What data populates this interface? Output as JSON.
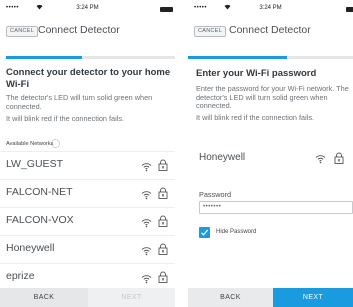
{
  "left_screen": {
    "status": {
      "signal": "•••••",
      "time": "3:24 PM"
    },
    "header": {
      "cancel": "CANCEL",
      "title": "Connect Detector"
    },
    "progress": 0.45,
    "title": "Connect your detector to your home Wi-Fi",
    "desc1": "The detector's LED will turn solid green when connected.",
    "desc2": "It will blink red if the connection fails.",
    "available_label": "Available Networks",
    "networks": [
      "LW_GUEST",
      "FALCON-NET",
      "FALCON-VOX",
      "Honeywell",
      "eprize"
    ],
    "footer": {
      "back": "BACK",
      "next": "NEXT"
    }
  },
  "right_screen": {
    "status": {
      "signal": "•••••",
      "time": "3:24 PM"
    },
    "header": {
      "cancel": "CANCEL",
      "title": "Connect Detector"
    },
    "progress": 0.6,
    "title": "Enter your Wi-Fi password",
    "desc1": "Enter the password for your Wi-Fi network. The detector's LED will turn solid green when connected.",
    "desc2": "It will blink red if the connection fails.",
    "selected_network": "Honeywell",
    "password_label": "Password",
    "password_value": "•••••••",
    "hide_password_label": "Hide Password",
    "hide_password_checked": true,
    "footer": {
      "back": "BACK",
      "next": "NEXT"
    }
  },
  "icons": {
    "wifi": "wifi-icon",
    "lock": "lock-icon",
    "spinner": "loading-spinner-icon",
    "check": "checkmark-icon"
  },
  "colors": {
    "accent": "#1a9be0",
    "footer_gray": "#e6e7e8"
  }
}
